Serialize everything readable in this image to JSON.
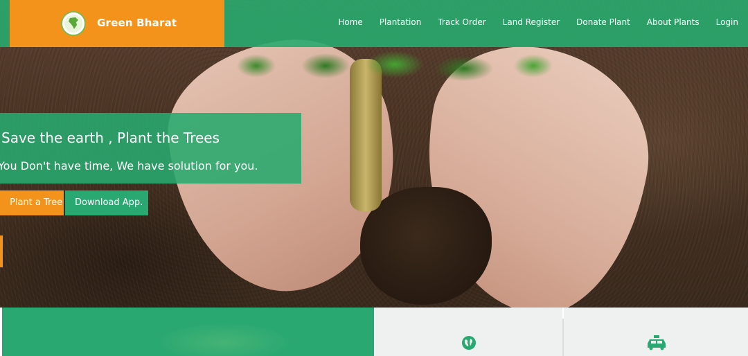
{
  "brand": {
    "name": "Green Bharat",
    "logo_icon": "india-map-globe-icon"
  },
  "nav": {
    "items": [
      "Home",
      "Plantation",
      "Track Order",
      "Land Register",
      "Donate Plant",
      "About Plants",
      "Login"
    ]
  },
  "hero": {
    "headline": "Save the earth , Plant the Trees",
    "subline": "You Don't have time, We have solution for you.",
    "buttons": {
      "plant": "Plant a Tree",
      "download": "Download App."
    }
  },
  "features": {
    "card1_icon": "globe-icon",
    "card2_icon": "taxi-icon"
  },
  "colors": {
    "primary_green": "#2aa872",
    "accent_orange": "#f3931b",
    "light_bg": "#eef1f0"
  }
}
